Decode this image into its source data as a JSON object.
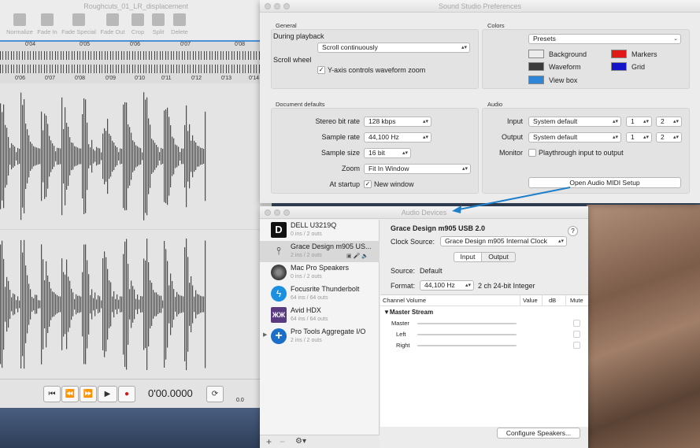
{
  "editor": {
    "title": "Roughcuts_01_LR_displacement",
    "toolbar": [
      {
        "label": "Normalize",
        "icon": "normalize-icon"
      },
      {
        "label": "Fade In",
        "icon": "fade-in-icon"
      },
      {
        "label": "Fade Special",
        "icon": "fade-special-icon"
      },
      {
        "label": "Fade Out",
        "icon": "fade-out-icon"
      },
      {
        "label": "Crop",
        "icon": "crop-icon"
      },
      {
        "label": "Split",
        "icon": "split-icon"
      },
      {
        "label": "Delete",
        "icon": "delete-icon"
      }
    ],
    "ruler_top": [
      "0'04",
      "0'05",
      "0'06",
      "0'07",
      "0'08"
    ],
    "ruler_bottom": [
      "0'06",
      "0'07",
      "0'08",
      "0'09",
      "0'10",
      "0'11",
      "0'12",
      "0'13",
      "0'14"
    ],
    "time": "0'00.0000",
    "level": "0.0"
  },
  "prefs": {
    "title": "Sound Studio Preferences",
    "general": {
      "group_label": "General",
      "during_playback_label": "During playback",
      "during_playback_value": "Scroll continuously",
      "scroll_wheel_label": "Scroll wheel",
      "yaxis_label": "Y-axis controls waveform zoom",
      "yaxis_checked": true
    },
    "colors": {
      "group_label": "Colors",
      "presets": "Presets",
      "items": [
        {
          "label": "Background",
          "color": "#ececec"
        },
        {
          "label": "Markers",
          "color": "#e01818"
        },
        {
          "label": "Waveform",
          "color": "#3c3c3c"
        },
        {
          "label": "Grid",
          "color": "#1414c8"
        },
        {
          "label": "View box",
          "color": "#2f86d8"
        }
      ]
    },
    "doc": {
      "group_label": "Document defaults",
      "stereo_label": "Stereo bit rate",
      "stereo_value": "128 kbps",
      "sample_rate_label": "Sample rate",
      "sample_rate_value": "44,100 Hz",
      "sample_size_label": "Sample size",
      "sample_size_value": "16 bit",
      "zoom_label": "Zoom",
      "zoom_value": "Fit In Window",
      "startup_label": "At startup",
      "startup_value": "New window",
      "startup_checked": true
    },
    "audio": {
      "group_label": "Audio",
      "input_label": "Input",
      "input_value": "System default",
      "input_ch1": "1",
      "input_ch2": "2",
      "output_label": "Output",
      "output_value": "System default",
      "output_ch1": "1",
      "output_ch2": "2",
      "monitor_label": "Monitor",
      "monitor_check_label": "Playthrough input to output",
      "midi_button": "Open Audio MIDI Setup"
    }
  },
  "audio_devices": {
    "title": "Audio Devices",
    "devices": [
      {
        "name": "DELL U3219Q",
        "io": "0 ins / 2 outs",
        "icon": "displayport-icon"
      },
      {
        "name": "Grace Design m905 US...",
        "io": "2 ins / 2 outs",
        "icon": "usb-icon",
        "selected": true
      },
      {
        "name": "Mac Pro Speakers",
        "io": "0 ins / 2 outs",
        "icon": "speaker-icon"
      },
      {
        "name": "Focusrite Thunderbolt",
        "io": "64 ins / 64 outs",
        "icon": "thunderbolt-icon"
      },
      {
        "name": "Avid HDX",
        "io": "64 ins / 64 outs",
        "icon": "avid-icon"
      },
      {
        "name": "Pro Tools Aggregate I/O",
        "io": "2 ins / 2 outs",
        "icon": "aggregate-plus-icon"
      }
    ],
    "footer": {
      "add": "+",
      "remove": "−",
      "gear": "⚙▾"
    },
    "detail": {
      "device_name": "Grace Design m905 USB 2.0",
      "help": "?",
      "clock_label": "Clock Source:",
      "clock_value": "Grace Design m905 Internal Clock",
      "tab_input": "Input",
      "tab_output": "Output",
      "source_label": "Source:",
      "source_value": "Default",
      "format_label": "Format:",
      "format_value": "44,100 Hz",
      "format_extra": "2 ch 24-bit Integer",
      "columns": [
        "Channel Volume",
        "Value",
        "dB",
        "Mute"
      ],
      "stream": "Master Stream",
      "channels": [
        "Master",
        "Left",
        "Right"
      ],
      "configure_button": "Configure Speakers..."
    }
  }
}
